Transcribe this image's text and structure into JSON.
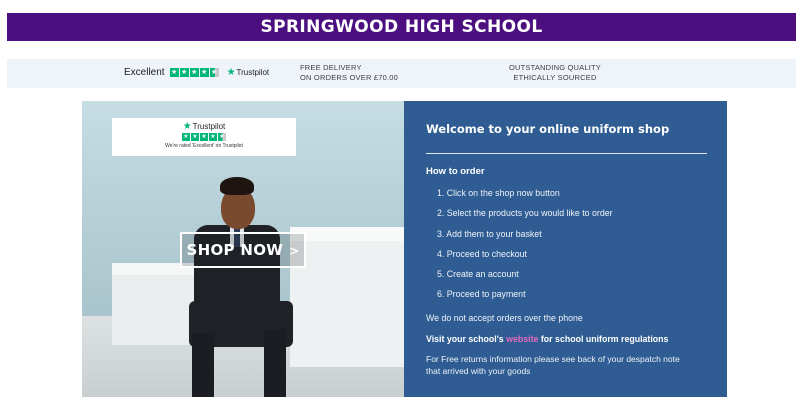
{
  "header": {
    "title": "SPRINGWOOD HIGH SCHOOL"
  },
  "strip": {
    "rating_word": "Excellent",
    "trustpilot_brand": "Trustpilot",
    "delivery": {
      "line1": "FREE DELIVERY",
      "line2": "ON ORDERS OVER £70.00"
    },
    "quality": {
      "line1": "OUTSTANDING QUALITY",
      "line2": "ETHICALLY SOURCED"
    }
  },
  "hero": {
    "trustpilot_card": {
      "brand": "Trustpilot",
      "rated_text": "We're rated 'Excellent' on Trustpilot"
    },
    "shop_button": {
      "label": "SHOP NOW",
      "chevron": ">"
    }
  },
  "panel": {
    "title": "Welcome to your online uniform shop",
    "how_to_order": "How to order",
    "steps": [
      "1. Click on the shop now button",
      "2. Select the products you would like to order",
      "3. Add them to your basket",
      "4. Proceed to checkout",
      "5. Create an account",
      "6. Proceed to payment"
    ],
    "phone_note": "We do not accept orders over the phone",
    "visit": {
      "prefix": "Visit your school's ",
      "link": "website",
      "suffix": " for school uniform regulations"
    },
    "returns": "For Free returns information please see back of your despatch note that arrived with your goods"
  },
  "colors": {
    "header_bg": "#4b0f80",
    "panel_bg": "#2f5c93",
    "strip_bg": "#eef4fa",
    "trustpilot_green": "#00b67a",
    "link_pink": "#e86ac0"
  }
}
